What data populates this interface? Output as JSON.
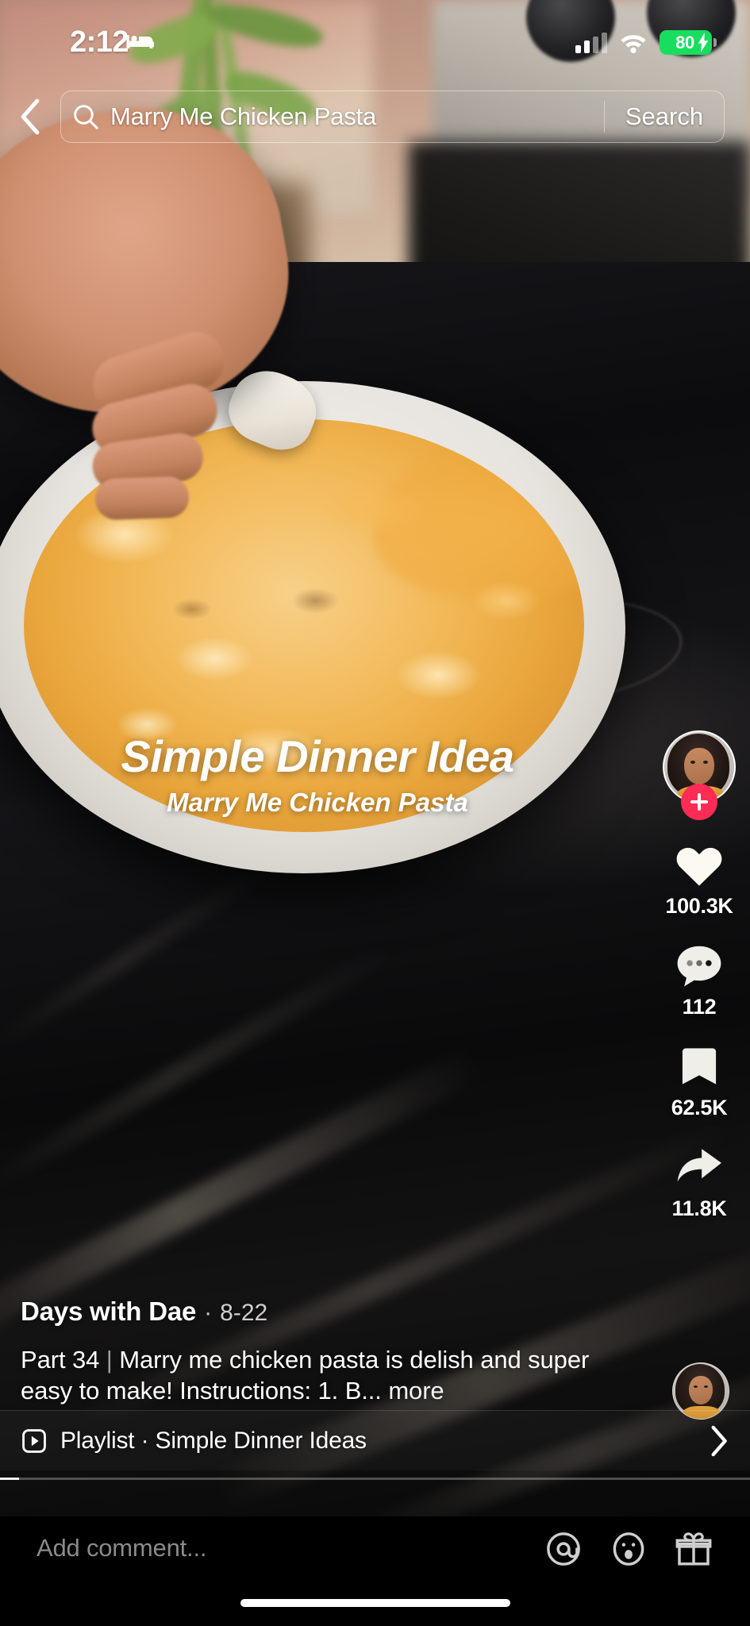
{
  "status_bar": {
    "time": "2:12",
    "focus_icon": "bed-icon",
    "signal_icon": "cellular-signal-icon",
    "wifi_icon": "wifi-icon",
    "battery_percent": "80",
    "battery_charging": true
  },
  "search": {
    "back_icon": "chevron-left-icon",
    "search_icon": "search-icon",
    "query": "Marry Me Chicken Pasta",
    "placeholder": "Search",
    "button_label": "Search"
  },
  "video_overlay": {
    "title": "Simple Dinner Idea",
    "subtitle": "Marry Me Chicken Pasta"
  },
  "action_rail": {
    "avatar_name": "creator-avatar",
    "follow_icon": "plus-icon",
    "items": [
      {
        "icon": "heart-icon",
        "name": "like-button",
        "count": "100.3K"
      },
      {
        "icon": "comment-icon",
        "name": "comment-button",
        "count": "112"
      },
      {
        "icon": "bookmark-icon",
        "name": "bookmark-button",
        "count": "62.5K"
      },
      {
        "icon": "share-icon",
        "name": "share-button",
        "count": "11.8K"
      }
    ]
  },
  "post": {
    "author": "Days with Dae",
    "separator": "·",
    "date": "8-22",
    "description_part1": "Part 34 ",
    "description_bar": "|",
    "description_part2": " Marry me chicken pasta is delish and super easy to make!  Instructions: 1. B...",
    "more_label": "more"
  },
  "playlist": {
    "icon": "playlist-icon",
    "label": "Playlist",
    "separator": "·",
    "name": "Simple Dinner Ideas",
    "chevron_icon": "chevron-right-icon"
  },
  "comment_bar": {
    "placeholder": "Add comment...",
    "icons": [
      {
        "name": "mention-icon",
        "glyph": "@"
      },
      {
        "name": "emoji-icon",
        "glyph": "☺"
      },
      {
        "name": "gift-icon",
        "glyph": "gift"
      }
    ]
  },
  "colors": {
    "follow_red": "#fe2c55",
    "battery_green": "#19dd5f",
    "background": "#000000"
  }
}
